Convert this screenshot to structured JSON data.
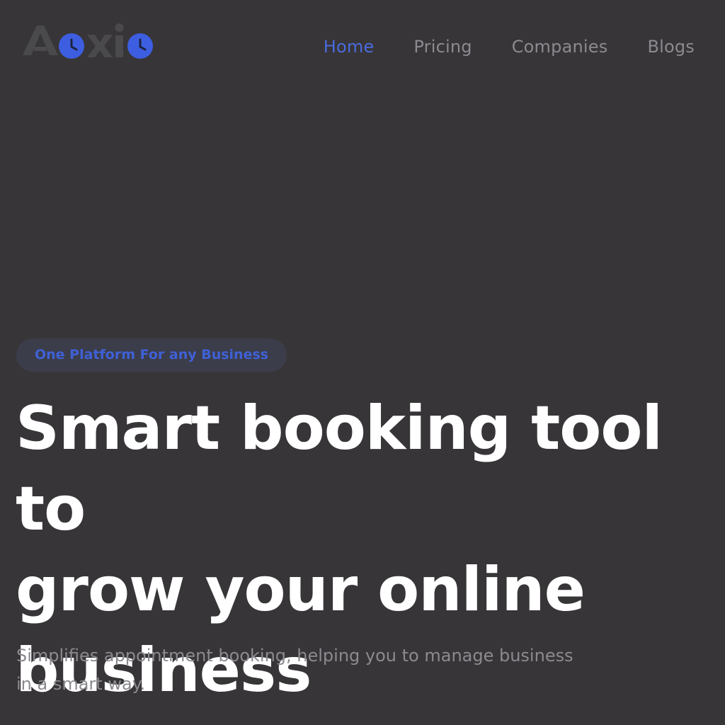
{
  "brand": {
    "name": "Aoxio",
    "logo_text_color": "#4a494c",
    "logo_accent_color": "#3d5ee0"
  },
  "nav": {
    "items": [
      {
        "label": "Home",
        "active": true
      },
      {
        "label": "Pricing",
        "active": false
      },
      {
        "label": "Companies",
        "active": false
      },
      {
        "label": "Blogs",
        "active": false
      }
    ]
  },
  "hero": {
    "badge": "One Platform For any Business",
    "headline_lines": [
      "Smart booking tool to",
      "grow your online",
      "business"
    ],
    "subtitle_lines": [
      "Simplifies appointment booking, helping you to manage business",
      "in a smart way."
    ]
  },
  "colors": {
    "background": "#373537",
    "accent": "#4b6bdc",
    "nav_text": "#8c8a90",
    "headline": "#ffffff",
    "badge_bg": "#3c3d4b"
  }
}
